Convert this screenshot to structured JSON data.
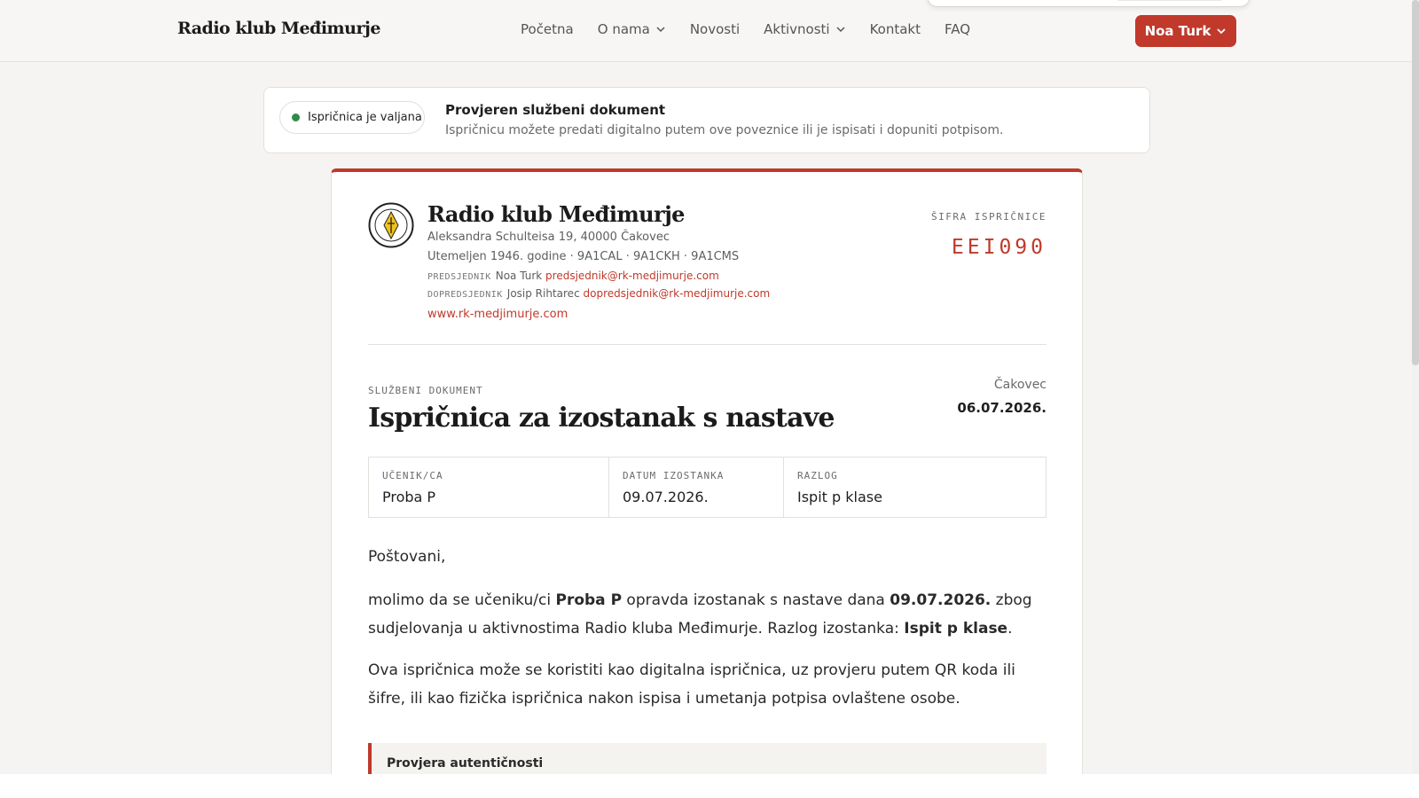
{
  "header": {
    "brand": "Radio klub Međimurje",
    "nav": [
      {
        "label": "Početna",
        "has_dropdown": false
      },
      {
        "label": "O nama",
        "has_dropdown": true
      },
      {
        "label": "Novosti",
        "has_dropdown": false
      },
      {
        "label": "Aktivnosti",
        "has_dropdown": true
      },
      {
        "label": "Kontakt",
        "has_dropdown": false
      },
      {
        "label": "FAQ",
        "has_dropdown": false
      }
    ],
    "user_button": "Noa Turk"
  },
  "status": {
    "badge": "Ispričnica je valjana",
    "title": "Provjeren službeni dokument",
    "subtitle": "Ispričnicu možete predati digitalno putem ove poveznice ili je ispisati i dopuniti potpisom."
  },
  "document": {
    "org_name": "Radio klub Međimurje",
    "address": "Aleksandra Schulteisa 19, 40000 Čakovec",
    "founded": "Utemeljen 1946. godine · 9A1CAL · 9A1CKH · 9A1CMS",
    "president_label": "PREDSJEDNIK",
    "president_name": "Noa Turk",
    "president_email": "predsjednik@rk-medjimurje.com",
    "vice_label": "DOPREDSJEDNIK",
    "vice_name": "Josip Rihtarec",
    "vice_email": "dopredsjednik@rk-medjimurje.com",
    "website": "www.rk-medjimurje.com",
    "code_label": "ŠIFRA ISPRIČNICE",
    "code_value": "EEI090",
    "kind": "SLUŽBENI DOKUMENT",
    "title": "Ispričnica za izostanak s nastave",
    "place": "Čakovec",
    "date": "06.07.2026.",
    "fields": [
      {
        "label": "UČENIK/CA",
        "value": "Proba P"
      },
      {
        "label": "DATUM IZOSTANKA",
        "value": "09.07.2026."
      },
      {
        "label": "RAZLOG",
        "value": "Ispit p klase"
      }
    ],
    "greeting": "Poštovani,",
    "para1_a": "molimo da se učeniku/ci ",
    "para1_student": "Proba P",
    "para1_b": " opravda izostanak s nastave dana ",
    "para1_date": "09.07.2026.",
    "para1_c": " zbog sudjelovanja u aktivnostima Radio kluba Međimurje. Razlog izostanka: ",
    "para1_reason": "Ispit p klase",
    "para1_d": ".",
    "para2": "Ova ispričnica može se koristiti kao digitalna ispričnica, uz provjeru putem QR koda ili šifre, ili kao fizička ispričnica nakon ispisa i umetanja potpisa ovlaštene osobe.",
    "auth_title": "Provjera autentičnosti"
  },
  "colors": {
    "accent": "#c0392b",
    "valid": "#2f8a4b"
  }
}
